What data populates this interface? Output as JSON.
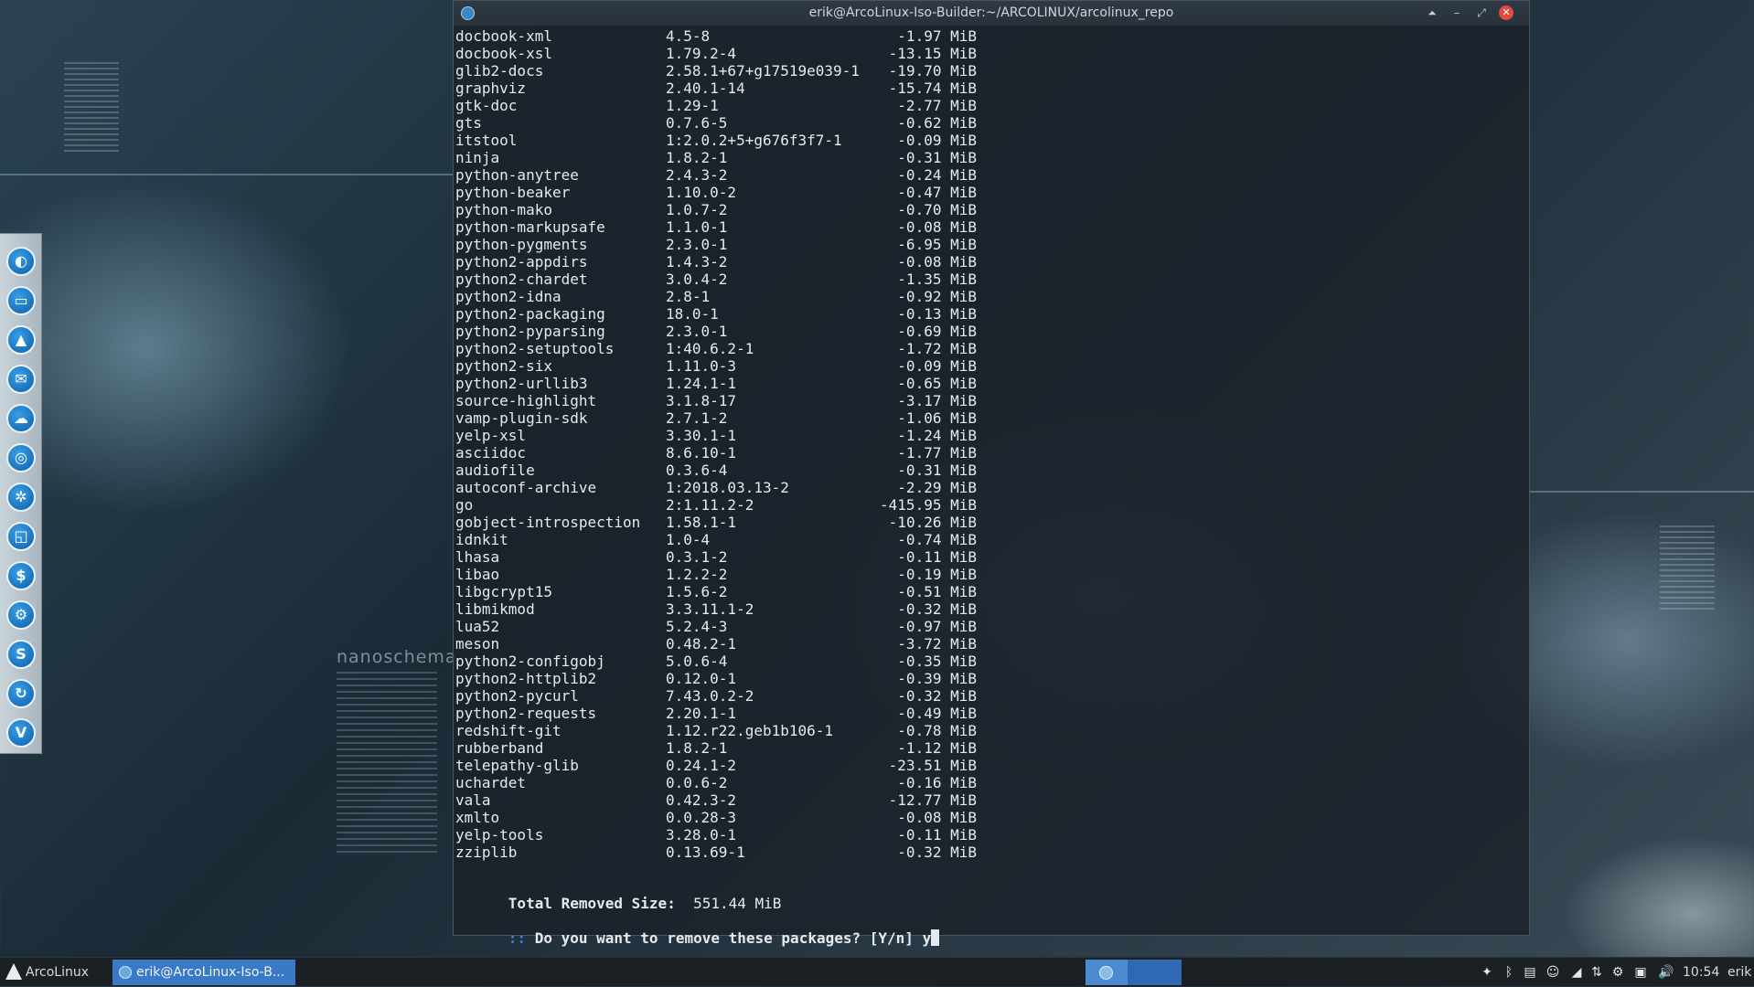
{
  "window": {
    "title": "erik@ArcoLinux-Iso-Builder:~/ARCOLINUX/arcolinux_repo",
    "buttons": [
      "⏶",
      "–",
      "⤢",
      "✕"
    ]
  },
  "packages": [
    {
      "name": "docbook-xml",
      "version": "4.5-8",
      "size": "-1.97 MiB"
    },
    {
      "name": "docbook-xsl",
      "version": "1.79.2-4",
      "size": "-13.15 MiB"
    },
    {
      "name": "glib2-docs",
      "version": "2.58.1+67+g17519e039-1",
      "size": "-19.70 MiB"
    },
    {
      "name": "graphviz",
      "version": "2.40.1-14",
      "size": "-15.74 MiB"
    },
    {
      "name": "gtk-doc",
      "version": "1.29-1",
      "size": "-2.77 MiB"
    },
    {
      "name": "gts",
      "version": "0.7.6-5",
      "size": "-0.62 MiB"
    },
    {
      "name": "itstool",
      "version": "1:2.0.2+5+g676f3f7-1",
      "size": "-0.09 MiB"
    },
    {
      "name": "ninja",
      "version": "1.8.2-1",
      "size": "-0.31 MiB"
    },
    {
      "name": "python-anytree",
      "version": "2.4.3-2",
      "size": "-0.24 MiB"
    },
    {
      "name": "python-beaker",
      "version": "1.10.0-2",
      "size": "-0.47 MiB"
    },
    {
      "name": "python-mako",
      "version": "1.0.7-2",
      "size": "-0.70 MiB"
    },
    {
      "name": "python-markupsafe",
      "version": "1.1.0-1",
      "size": "-0.08 MiB"
    },
    {
      "name": "python-pygments",
      "version": "2.3.0-1",
      "size": "-6.95 MiB"
    },
    {
      "name": "python2-appdirs",
      "version": "1.4.3-2",
      "size": "-0.08 MiB"
    },
    {
      "name": "python2-chardet",
      "version": "3.0.4-2",
      "size": "-1.35 MiB"
    },
    {
      "name": "python2-idna",
      "version": "2.8-1",
      "size": "-0.92 MiB"
    },
    {
      "name": "python2-packaging",
      "version": "18.0-1",
      "size": "-0.13 MiB"
    },
    {
      "name": "python2-pyparsing",
      "version": "2.3.0-1",
      "size": "-0.69 MiB"
    },
    {
      "name": "python2-setuptools",
      "version": "1:40.6.2-1",
      "size": "-1.72 MiB"
    },
    {
      "name": "python2-six",
      "version": "1.11.0-3",
      "size": "-0.09 MiB"
    },
    {
      "name": "python2-urllib3",
      "version": "1.24.1-1",
      "size": "-0.65 MiB"
    },
    {
      "name": "source-highlight",
      "version": "3.1.8-17",
      "size": "-3.17 MiB"
    },
    {
      "name": "vamp-plugin-sdk",
      "version": "2.7.1-2",
      "size": "-1.06 MiB"
    },
    {
      "name": "yelp-xsl",
      "version": "3.30.1-1",
      "size": "-1.24 MiB"
    },
    {
      "name": "asciidoc",
      "version": "8.6.10-1",
      "size": "-1.77 MiB"
    },
    {
      "name": "audiofile",
      "version": "0.3.6-4",
      "size": "-0.31 MiB"
    },
    {
      "name": "autoconf-archive",
      "version": "1:2018.03.13-2",
      "size": "-2.29 MiB"
    },
    {
      "name": "go",
      "version": "2:1.11.2-2",
      "size": "-415.95 MiB"
    },
    {
      "name": "gobject-introspection",
      "version": "1.58.1-1",
      "size": "-10.26 MiB"
    },
    {
      "name": "idnkit",
      "version": "1.0-4",
      "size": "-0.74 MiB"
    },
    {
      "name": "lhasa",
      "version": "0.3.1-2",
      "size": "-0.11 MiB"
    },
    {
      "name": "libao",
      "version": "1.2.2-2",
      "size": "-0.19 MiB"
    },
    {
      "name": "libgcrypt15",
      "version": "1.5.6-2",
      "size": "-0.51 MiB"
    },
    {
      "name": "libmikmod",
      "version": "3.3.11.1-2",
      "size": "-0.32 MiB"
    },
    {
      "name": "lua52",
      "version": "5.2.4-3",
      "size": "-0.97 MiB"
    },
    {
      "name": "meson",
      "version": "0.48.2-1",
      "size": "-3.72 MiB"
    },
    {
      "name": "python2-configobj",
      "version": "5.0.6-4",
      "size": "-0.35 MiB"
    },
    {
      "name": "python2-httplib2",
      "version": "0.12.0-1",
      "size": "-0.39 MiB"
    },
    {
      "name": "python2-pycurl",
      "version": "7.43.0.2-2",
      "size": "-0.32 MiB"
    },
    {
      "name": "python2-requests",
      "version": "2.20.1-1",
      "size": "-0.49 MiB"
    },
    {
      "name": "redshift-git",
      "version": "1.12.r22.geb1b106-1",
      "size": "-0.78 MiB"
    },
    {
      "name": "rubberband",
      "version": "1.8.2-1",
      "size": "-1.12 MiB"
    },
    {
      "name": "telepathy-glib",
      "version": "0.24.1-2",
      "size": "-23.51 MiB"
    },
    {
      "name": "uchardet",
      "version": "0.0.6-2",
      "size": "-0.16 MiB"
    },
    {
      "name": "vala",
      "version": "0.42.3-2",
      "size": "-12.77 MiB"
    },
    {
      "name": "xmlto",
      "version": "0.0.28-3",
      "size": "-0.08 MiB"
    },
    {
      "name": "yelp-tools",
      "version": "3.28.0-1",
      "size": "-0.11 MiB"
    },
    {
      "name": "zziplib",
      "version": "0.13.69-1",
      "size": "-0.32 MiB"
    }
  ],
  "summary": {
    "total_label": "Total Removed Size:",
    "total_value": "551.44 MiB"
  },
  "prompt": {
    "prefix": "::",
    "question": "Do you want to remove these packages? [Y/n]",
    "input": "y"
  },
  "wallpaper": {
    "brand_text": "nanoschema"
  },
  "dock": {
    "items": [
      {
        "icon": "firefox-icon",
        "glyph": "◐"
      },
      {
        "icon": "file-manager-icon",
        "glyph": "▭"
      },
      {
        "icon": "archlinux-icon",
        "glyph": "▲"
      },
      {
        "icon": "thunderbird-icon",
        "glyph": "✉"
      },
      {
        "icon": "mail-icon",
        "glyph": "☁"
      },
      {
        "icon": "chrome-icon",
        "glyph": "◎"
      },
      {
        "icon": "aperture-icon",
        "glyph": "✲"
      },
      {
        "icon": "window-icon",
        "glyph": "◱"
      },
      {
        "icon": "terminal-icon",
        "glyph": "$"
      },
      {
        "icon": "settings-icon",
        "glyph": "⚙"
      },
      {
        "icon": "skype-icon",
        "glyph": "S"
      },
      {
        "icon": "refresh-icon",
        "glyph": "↻"
      },
      {
        "icon": "vivaldi-icon",
        "glyph": "V"
      }
    ]
  },
  "taskbar": {
    "start_label": "ArcoLinux",
    "task_label": "erik@ArcoLinux-Iso-B...",
    "clock": "10:54",
    "user": "erik",
    "tray_icons": [
      {
        "icon": "dropbox-icon",
        "glyph": "✦"
      },
      {
        "icon": "bluetooth-icon",
        "glyph": "ᛒ"
      },
      {
        "icon": "clipboard-icon",
        "glyph": "▤"
      },
      {
        "icon": "discord-icon",
        "glyph": "☺"
      },
      {
        "icon": "network-signal-icon",
        "glyph": "◢"
      },
      {
        "icon": "network-transfer-icon",
        "glyph": "⇅"
      },
      {
        "icon": "system-settings-icon",
        "glyph": "⚙"
      },
      {
        "icon": "display-icon",
        "glyph": "▣"
      },
      {
        "icon": "volume-icon",
        "glyph": "🔊"
      }
    ]
  },
  "colors": {
    "prompt_prefix": "#3f7fd6",
    "task_active": "#3a79c4",
    "close_button": "#e3493e"
  }
}
